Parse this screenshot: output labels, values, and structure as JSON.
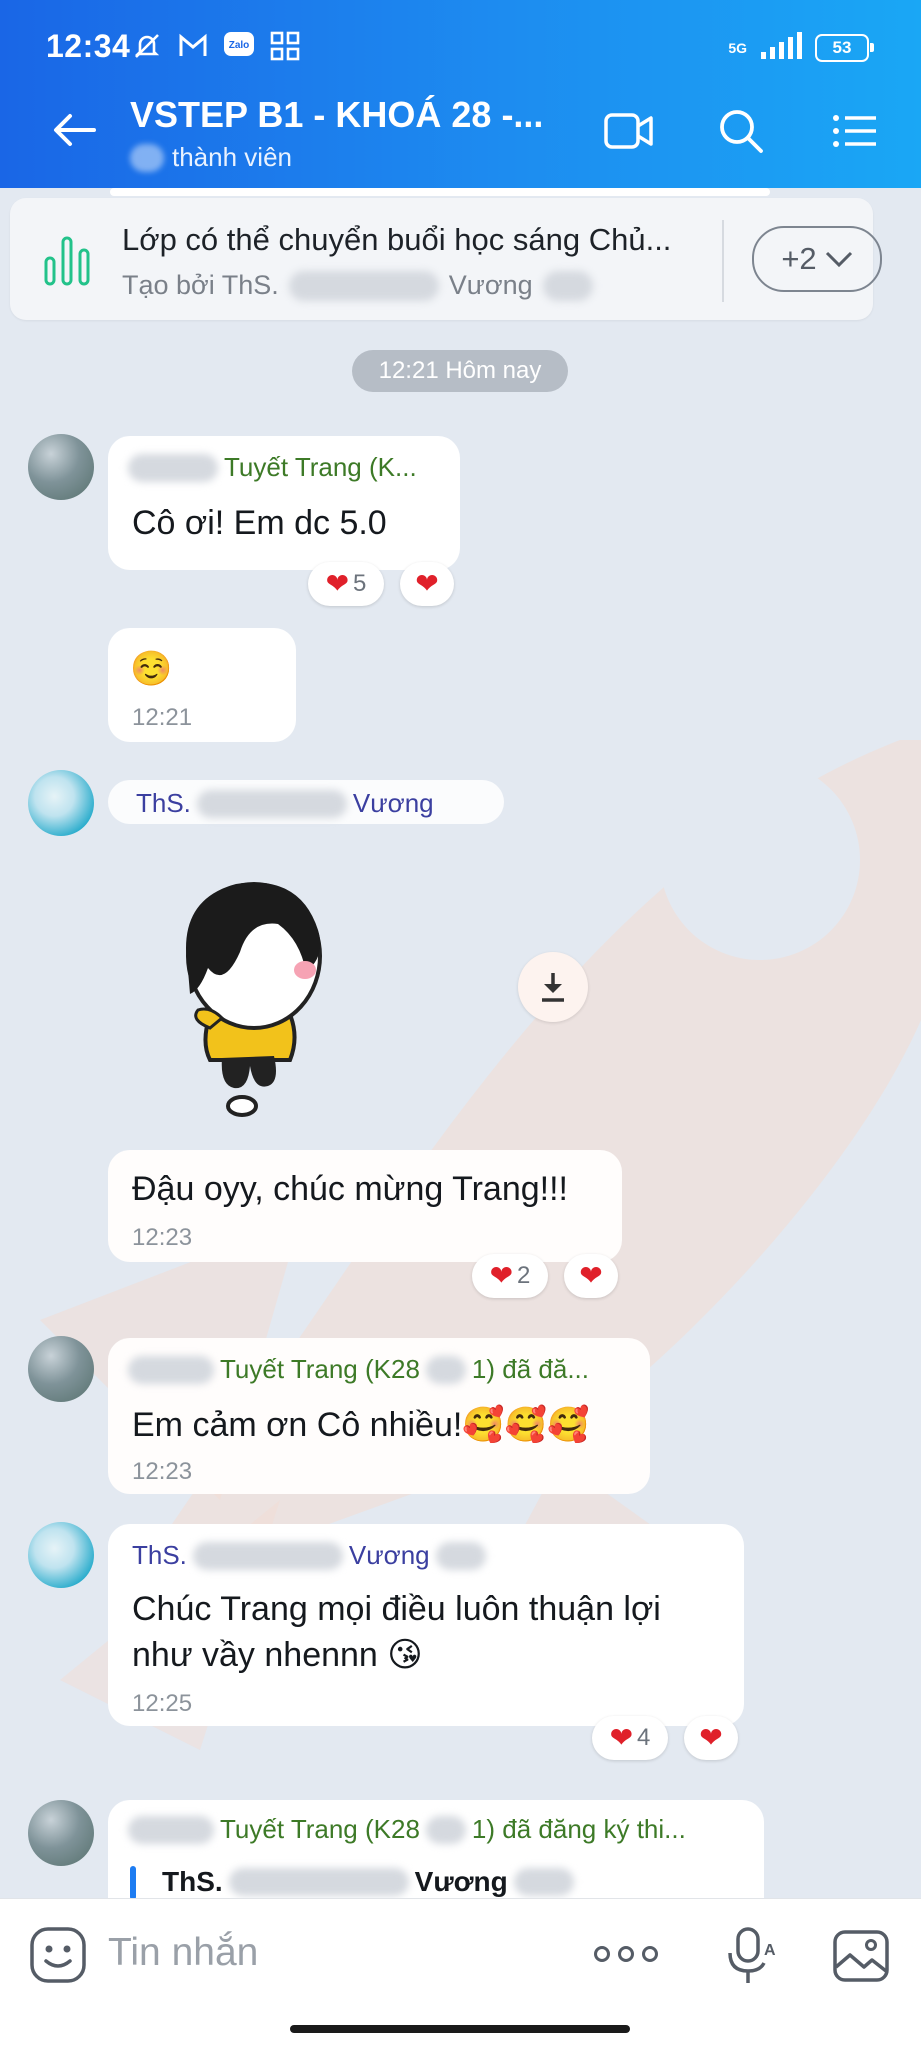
{
  "status_bar": {
    "time": "12:34",
    "network": "5G",
    "battery": "53",
    "icons": [
      "do-not-disturb-icon",
      "gmail-icon",
      "zalo-icon",
      "apps-icon",
      "signal-icon"
    ]
  },
  "header": {
    "title": "VSTEP B1 - KHOÁ 28 -...",
    "subtitle_suffix": "thành viên",
    "icons": [
      "back-arrow-icon",
      "video-call-icon",
      "search-icon",
      "menu-icon"
    ]
  },
  "pinned": {
    "title": "Lớp có thể chuyển buổi học sáng Chủ...",
    "created_by_prefix": "Tạo bởi ThS.",
    "created_by_suffix": "Vương",
    "more_label": "+2"
  },
  "date_separator": "12:21 Hôm nay",
  "messages": [
    {
      "sender": "Tuyết Trang (K...",
      "text": "Cô ơi! Em dc 5.0",
      "reaction_count": "5"
    },
    {
      "text": "☺️",
      "time": "12:21"
    },
    {
      "sender_prefix": "ThS.",
      "sender_suffix": "Vương"
    },
    {
      "text": "Đậu oyy, chúc mừng Trang!!!",
      "time": "12:23",
      "reaction_count": "2"
    },
    {
      "sender_mid": "Tuyết Trang (K28",
      "sender_end": "1) đã đă...",
      "text": "Em cảm ơn Cô nhiều!🥰🥰🥰",
      "time": "12:23"
    },
    {
      "sender_prefix": "ThS.",
      "sender_suffix": "Vương",
      "line1": "Chúc Trang mọi điều luôn thuận lợi",
      "line2": "như vầy nhennn 😘",
      "time": "12:25",
      "reaction_count": "4"
    },
    {
      "sender_mid": "Tuyết Trang (K28",
      "sender_end": "1) đã đăng ký thi...",
      "quote_prefix": "ThS.",
      "quote_suffix": "Vương"
    }
  ],
  "input": {
    "placeholder": "Tin nhắn"
  },
  "colors": {
    "header_start": "#1a66e6",
    "header_end": "#1aa7f5",
    "chat_bg": "#e3e9f1",
    "heart": "#e0202a",
    "sender_green": "#3d7a27",
    "sender_purple": "#3b3fa0"
  }
}
